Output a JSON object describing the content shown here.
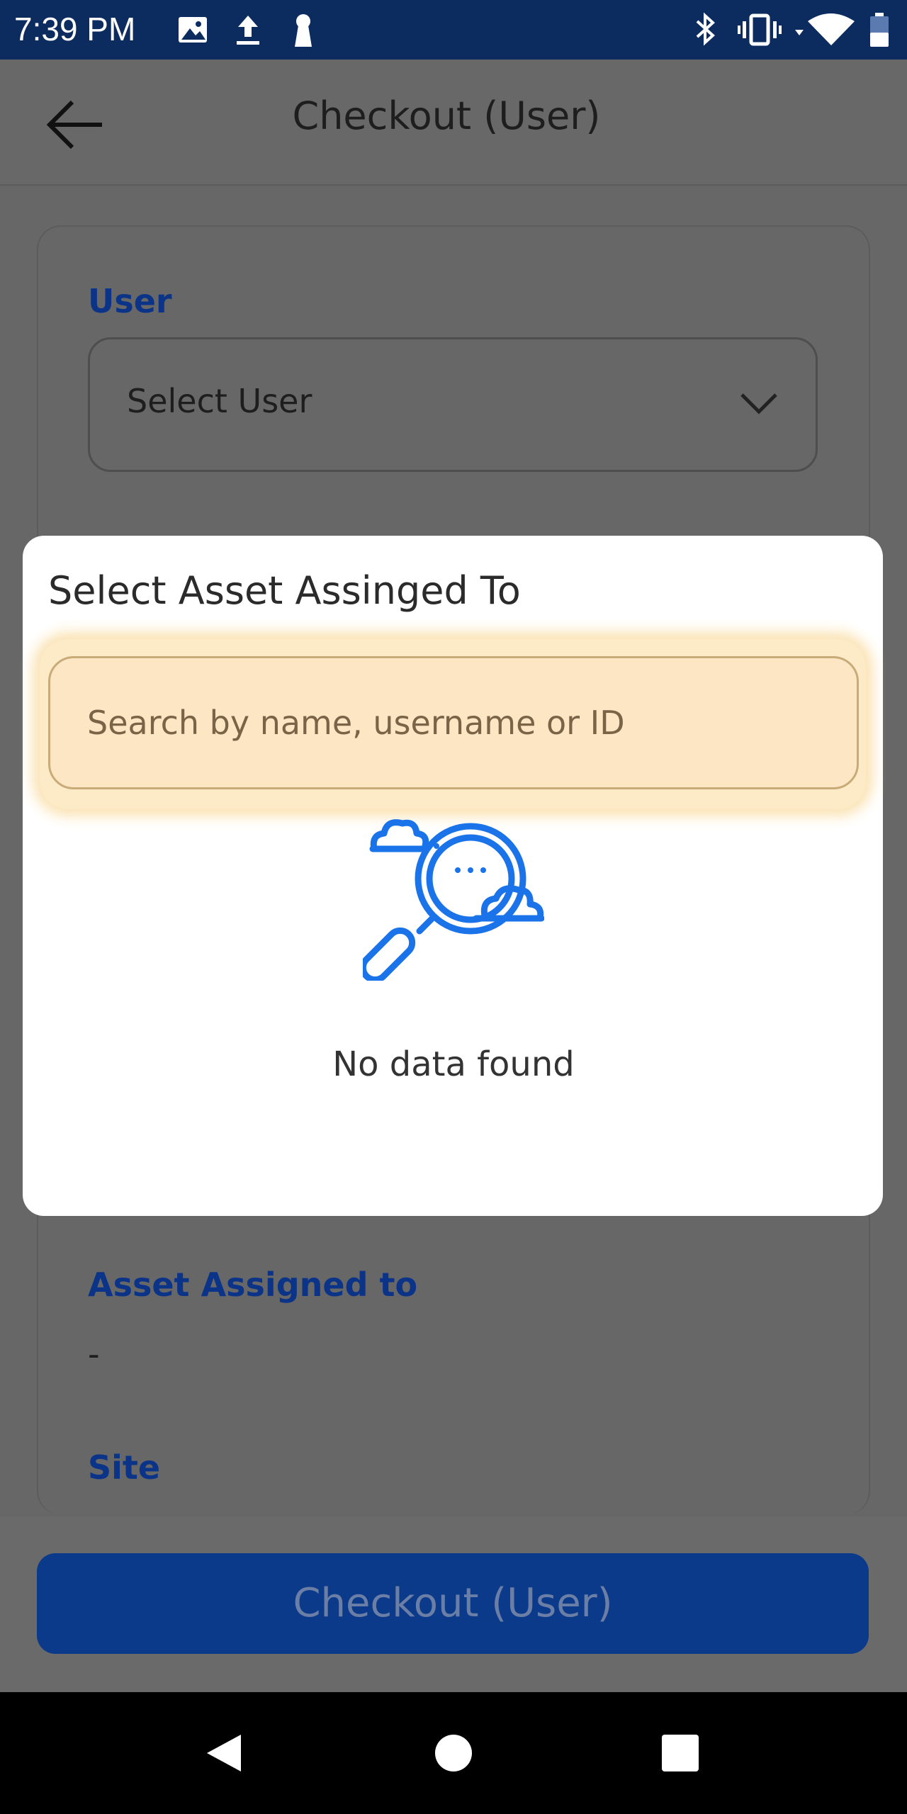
{
  "status_bar": {
    "time": "7:39 PM",
    "left_icons": [
      "image-icon",
      "upload-icon",
      "keyhole-icon"
    ],
    "right_icons": [
      "bluetooth-icon",
      "vibrate-icon",
      "wifi-icon",
      "battery-icon"
    ]
  },
  "app_bar": {
    "back_icon": "arrow-left-icon",
    "title": "Checkout (User)"
  },
  "form": {
    "user_label": "User",
    "user_select_value": "Select User",
    "asset_assigned_label": "Asset Assigned to",
    "asset_assigned_value": "-",
    "site_label": "Site"
  },
  "footer": {
    "checkout_button": "Checkout (User)"
  },
  "dialog": {
    "title": "Select Asset Assinged To",
    "search_placeholder": "Search by name, username or ID",
    "empty_icon": "magnifier-cloud-icon",
    "empty_text": "No data found"
  },
  "nav_bar": {
    "icons": [
      "back-triangle-icon",
      "home-circle-icon",
      "recents-square-icon"
    ]
  },
  "colors": {
    "status_bar": "#0c2c60",
    "accent_blue": "#0b3488",
    "button_blue": "#0b3a8a",
    "search_highlight": "#fde6c4",
    "illustration_blue": "#1a73e8"
  }
}
